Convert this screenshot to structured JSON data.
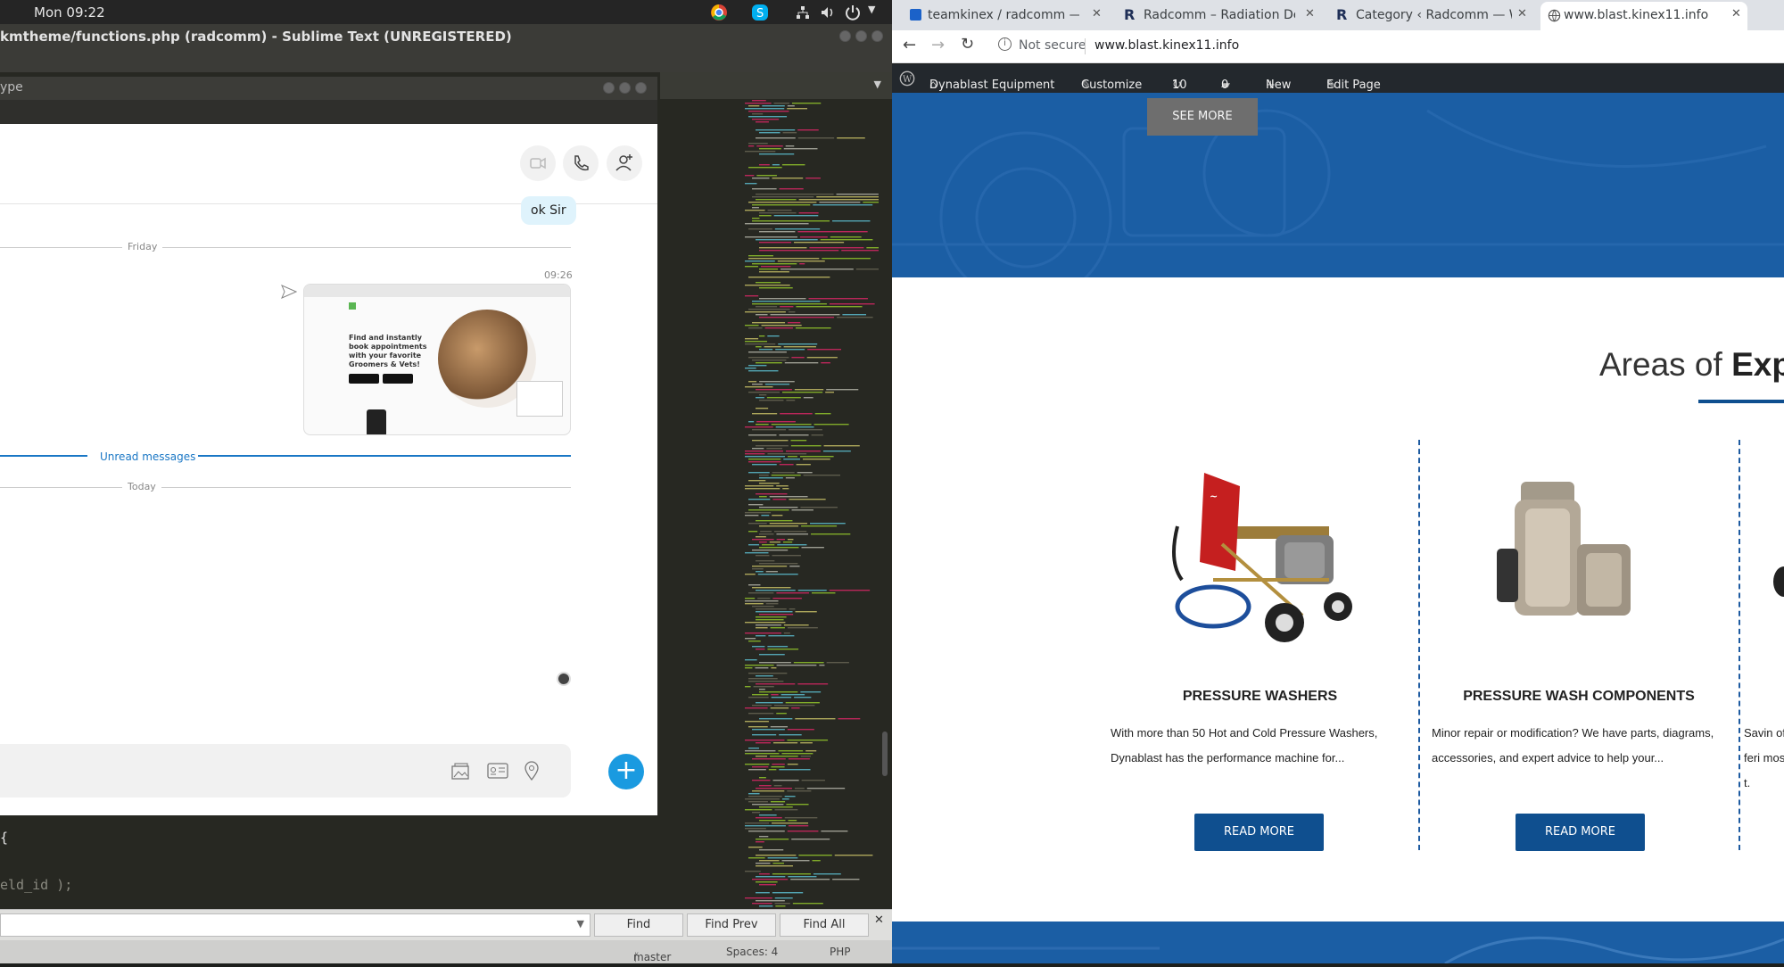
{
  "system": {
    "clock": "Mon 09:22"
  },
  "sublime": {
    "title": "kmtheme/functions.php (radcomm) - Sublime Text (UNREGISTERED)",
    "code_line1": "{",
    "code_line2": "eld_id );",
    "find": {
      "placeholder": "",
      "find_label": "Find",
      "find_prev_label": "Find Prev",
      "find_all_label": "Find All"
    },
    "status": {
      "branch": "master",
      "spaces": "Spaces: 4",
      "syntax": "PHP"
    }
  },
  "skype": {
    "window_title": "ype",
    "messages": {
      "ok": "ok Sir",
      "time": "09:26"
    },
    "dividers": {
      "friday": "Friday",
      "unread": "Unread messages",
      "today": "Today"
    },
    "shared_image_caption": "Find and instantly book appointments with your favorite Groomers & Vets!"
  },
  "chrome": {
    "tabs": [
      {
        "label": "teamkinex / radcomm — "
      },
      {
        "label": "Radcomm – Radiation De"
      },
      {
        "label": "Category ‹ Radcomm — W"
      },
      {
        "label": "www.blast.kinex11.info"
      }
    ],
    "not_secure": "Not secure",
    "url": "www.blast.kinex11.info"
  },
  "wp_admin_bar": {
    "site": "Dynablast Equipment",
    "customize": "Customize",
    "updates": "10",
    "comments": "0",
    "new": "New",
    "edit": "Edit Page"
  },
  "site": {
    "see_more": "SEE MORE",
    "areas_prefix": "Areas of ",
    "areas_bold": "Exp",
    "cards": [
      {
        "title": "PRESSURE WASHERS",
        "text": "With more than 50 Hot and Cold Pressure Washers, Dynablast has the performance machine for...",
        "button": "READ MORE"
      },
      {
        "title": "PRESSURE WASH COMPONENTS",
        "text": "Minor repair or modification? We have parts, diagrams, accessories, and expert advice to help your...",
        "button": "READ MORE"
      },
      {
        "title": "",
        "text": "Savin offeri most."
      }
    ]
  },
  "colors": {
    "accent": "#0f4f8f",
    "hero_blue": "#1b5ea4",
    "skype_blue": "#1a9ae0"
  }
}
